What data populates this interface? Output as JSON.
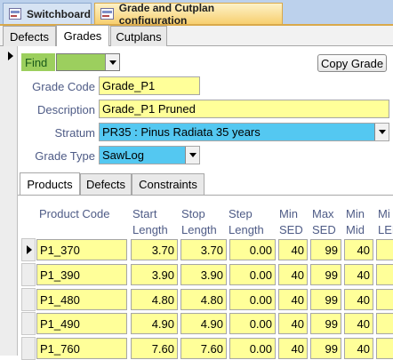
{
  "doc_tabs": [
    {
      "label": "Switchboard"
    },
    {
      "label": "Grade and Cutplan configuration"
    }
  ],
  "main_tabs": [
    {
      "label": "Defects"
    },
    {
      "label": "Grades"
    },
    {
      "label": "Cutplans"
    }
  ],
  "find": {
    "label": "Find",
    "value": ""
  },
  "copy_button": "Copy Grade",
  "form": {
    "grade_code": {
      "label": "Grade Code",
      "value": "Grade_P1"
    },
    "description": {
      "label": "Description",
      "value": "Grade_P1 Pruned"
    },
    "stratum": {
      "label": "Stratum",
      "value": "PR35 : Pinus Radiata 35 years"
    },
    "grade_type": {
      "label": "Grade Type",
      "value": "SawLog"
    }
  },
  "sub_tabs": [
    {
      "label": "Products"
    },
    {
      "label": "Defects"
    },
    {
      "label": "Constraints"
    }
  ],
  "grid": {
    "headers": [
      [
        "Product Code",
        ""
      ],
      [
        "Start",
        "Length"
      ],
      [
        "Stop",
        "Length"
      ],
      [
        "Step",
        "Length"
      ],
      [
        "Min",
        "SED"
      ],
      [
        "Max",
        "SED"
      ],
      [
        "Min",
        "Mid"
      ],
      [
        "Mi",
        "LED"
      ]
    ],
    "rows": [
      [
        "P1_370",
        "3.70",
        "3.70",
        "0.00",
        "40",
        "99",
        "40"
      ],
      [
        "P1_390",
        "3.90",
        "3.90",
        "0.00",
        "40",
        "99",
        "40"
      ],
      [
        "P1_480",
        "4.80",
        "4.80",
        "0.00",
        "40",
        "99",
        "40"
      ],
      [
        "P1_490",
        "4.90",
        "4.90",
        "0.00",
        "40",
        "99",
        "40"
      ],
      [
        "P1_760",
        "7.60",
        "7.60",
        "0.00",
        "40",
        "99",
        "40"
      ]
    ]
  }
}
